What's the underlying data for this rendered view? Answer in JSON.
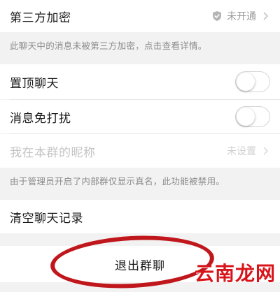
{
  "encryption": {
    "label": "第三方加密",
    "status": "未开通",
    "hint": "此聊天中的消息未被第三方加密，点击查看详情。"
  },
  "pin_chat": {
    "label": "置顶聊天",
    "enabled": false
  },
  "mute": {
    "label": "消息免打扰",
    "enabled": false
  },
  "nickname": {
    "label": "我在本群的昵称",
    "value": "未设置",
    "hint": "由于管理员开启了内部群仅显示真名，此功能被禁用。"
  },
  "clear_history": {
    "label": "清空聊天记录"
  },
  "exit_group": {
    "label": "退出群聊"
  },
  "watermark": "云南龙网",
  "colors": {
    "annotation": "#c0171d",
    "background": "#f2f2f2"
  },
  "icons": {
    "shield": "shield-icon",
    "chevron": "chevron-right-icon"
  }
}
